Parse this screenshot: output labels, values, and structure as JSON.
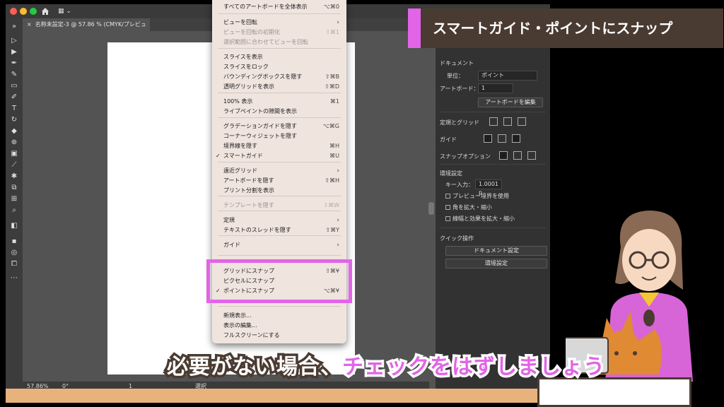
{
  "app": {
    "tab_title": "名称未設定-3 @ 57.86 % (CMYK/プレビュー)",
    "tab_close": "×"
  },
  "status": {
    "zoom": "57.86%",
    "rotation": "0°",
    "page": "1",
    "mode": "選択"
  },
  "menu": {
    "items": [
      {
        "label": "すべてのアートボードを全体表示",
        "shortcut": "⌥⌘0",
        "disabled": false
      },
      {
        "label": "ビューを回転",
        "arrow": "›",
        "disabled": false
      },
      {
        "label": "ビューを回転の初期化",
        "shortcut": "⇧⌘1",
        "disabled": true
      },
      {
        "label": "選択範囲に合わせてビューを回転",
        "disabled": true
      },
      {
        "label": "スライスを表示",
        "disabled": false
      },
      {
        "label": "スライスをロック",
        "disabled": false
      },
      {
        "label": "バウンディングボックスを隠す",
        "shortcut": "⇧⌘B",
        "disabled": false
      },
      {
        "label": "透明グリッドを表示",
        "shortcut": "⇧⌘D",
        "disabled": false
      },
      {
        "label": "100% 表示",
        "shortcut": "⌘1",
        "disabled": false
      },
      {
        "label": "ライブペイントの隙間を表示",
        "disabled": false
      },
      {
        "label": "グラデーションガイドを隠す",
        "shortcut": "⌥⌘G",
        "disabled": false
      },
      {
        "label": "コーナーウィジェットを隠す",
        "disabled": false
      },
      {
        "label": "境界線を隠す",
        "shortcut": "⌘H",
        "disabled": false
      },
      {
        "label": "スマートガイド",
        "shortcut": "⌘U",
        "checked": "✓",
        "disabled": false
      },
      {
        "label": "遠近グリッド",
        "arrow": "›",
        "disabled": false
      },
      {
        "label": "アートボードを隠す",
        "shortcut": "⇧⌘H",
        "disabled": false
      },
      {
        "label": "プリント分割を表示",
        "disabled": false
      },
      {
        "label": "テンプレートを隠す",
        "shortcut": "⇧⌘W",
        "disabled": true
      },
      {
        "label": "定規",
        "arrow": "›",
        "disabled": false
      },
      {
        "label": "テキストのスレッドを隠す",
        "shortcut": "⇧⌘Y",
        "disabled": false
      },
      {
        "label": "ガイド",
        "arrow": "›",
        "disabled": false
      },
      {
        "label": "グリッドにスナップ",
        "shortcut": "⇧⌘¥",
        "disabled": false
      },
      {
        "label": "ピクセルにスナップ",
        "disabled": false
      },
      {
        "label": "ポイントにスナップ",
        "shortcut": "⌥⌘¥",
        "checked": "✓",
        "disabled": false
      },
      {
        "label": "新規表示...",
        "disabled": false
      },
      {
        "label": "表示の編集...",
        "disabled": false
      },
      {
        "label": "フルスクリーンにする",
        "disabled": false
      }
    ]
  },
  "panel": {
    "document_label": "ドキュメント",
    "unit_label": "単位：",
    "unit_value": "ポイント",
    "artboard_label": "アートボード：",
    "artboard_value": "1",
    "artboard_edit_button": "アートボードを編集",
    "rulers_grid_label": "定規とグリッド",
    "guides_label": "ガイド",
    "snap_options_label": "スナップオプション",
    "prefs_label": "環境設定",
    "key_input_label": "キー入力：",
    "key_input_value": "1.0001 p",
    "preview_bounds": "プレビュー境界を使用",
    "scale_corners": "角を拡大・縮小",
    "scale_strokes": "線幅と効果を拡大・縮小",
    "quick_actions_label": "クイック操作",
    "doc_setup_button": "ドキュメント設定",
    "prefs_button": "環境設定"
  },
  "overlay": {
    "title": "スマートガイド・ポイントにスナップ",
    "caption_part1": "必要がない場合、",
    "caption_part2": "チェックをはずしましょう"
  },
  "colors": {
    "accent": "#e264e7",
    "banner": "#4a3b32",
    "menu_bg": "#f0e4df"
  }
}
